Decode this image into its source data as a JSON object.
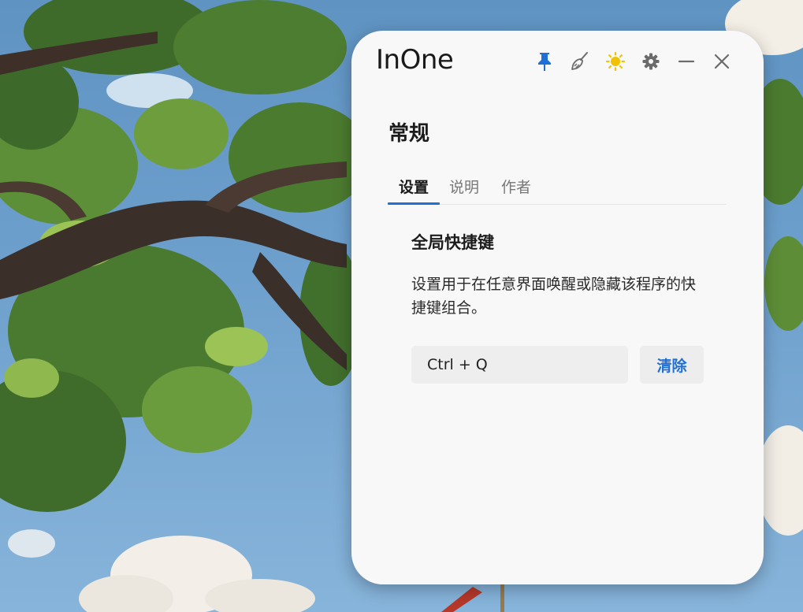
{
  "window": {
    "app_title": "InOne",
    "title_icons": [
      {
        "name": "pin-icon",
        "color": "#1e6fd6"
      },
      {
        "name": "broom-icon",
        "color": "#6b6b6b"
      },
      {
        "name": "sun-icon",
        "color": "#f2c200"
      },
      {
        "name": "gear-icon",
        "color": "#6b6b6b"
      },
      {
        "name": "minimize-icon",
        "color": "#6b6b6b"
      },
      {
        "name": "close-icon",
        "color": "#6b6b6b"
      }
    ]
  },
  "page": {
    "section_title": "常规",
    "tabs": [
      {
        "label": "设置",
        "active": true
      },
      {
        "label": "说明",
        "active": false
      },
      {
        "label": "作者",
        "active": false
      }
    ]
  },
  "shortcut": {
    "heading": "全局快捷键",
    "description": "设置用于在任意界面唤醒或隐藏该程序的快捷键组合。",
    "value": "Ctrl + Q",
    "clear_label": "清除"
  },
  "colors": {
    "accent": "#1e6fd6",
    "window_bg": "#f8f8f8",
    "sky": "#6ea0cd"
  }
}
